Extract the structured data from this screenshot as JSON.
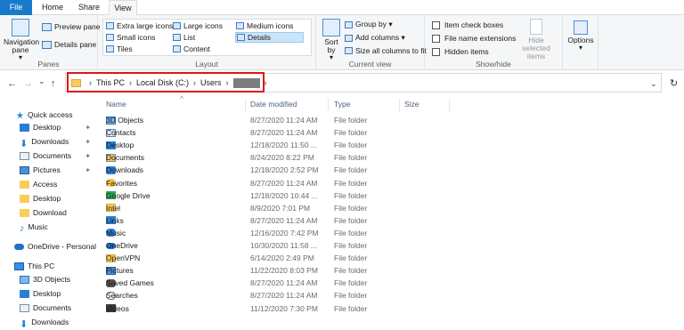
{
  "tabs": [
    "File",
    "Home",
    "Share",
    "View"
  ],
  "ribbon": {
    "panes": {
      "navigation_pane": "Navigation pane",
      "navigation_pane_arrow": "▾",
      "preview_pane": "Preview pane",
      "details_pane": "Details pane",
      "label": "Panes"
    },
    "layout": {
      "items": [
        "Extra large icons",
        "Large icons",
        "Medium icons",
        "Small icons",
        "List",
        "Details",
        "Tiles",
        "Content"
      ],
      "label": "Layout"
    },
    "current_view": {
      "sort_by": "Sort by",
      "sort_by_arrow": "▾",
      "group_by": "Group by ▾",
      "add_columns": "Add columns ▾",
      "size_all_columns": "Size all columns to fit",
      "label": "Current view"
    },
    "show_hide": {
      "item_check_boxes": "Item check boxes",
      "file_name_extensions": "File name extensions",
      "hidden_items": "Hidden items",
      "hide_selected": "Hide selected",
      "hide_selected_2": "items",
      "label": "Show/hide"
    },
    "options": {
      "label": "Options",
      "arrow": "▾"
    }
  },
  "nav": {
    "back": "←",
    "forward": "→",
    "recent": "⌄",
    "up": "↑",
    "dropdown": "⌄",
    "refresh": "↻"
  },
  "address": {
    "crumbs": [
      "This PC",
      "Local Disk (C:)",
      "Users"
    ],
    "separator": "›",
    "trailing": "›"
  },
  "navpane": {
    "pin": "✦",
    "items": [
      {
        "label": "Quick access",
        "icon": "star-icon"
      },
      {
        "label": "Desktop",
        "icon": "desktop-icon"
      },
      {
        "label": "Downloads",
        "icon": "download-icon"
      },
      {
        "label": "Documents",
        "icon": "documents-icon"
      },
      {
        "label": "Pictures",
        "icon": "pictures-icon"
      },
      {
        "label": "Access",
        "icon": "folder-icon"
      },
      {
        "label": "Desktop",
        "icon": "folder-icon"
      },
      {
        "label": "Download",
        "icon": "folder-icon"
      },
      {
        "label": "Music",
        "icon": "music-icon"
      },
      {
        "label": "OneDrive - Personal",
        "icon": "cloud-icon"
      },
      {
        "label": "This PC",
        "icon": "computer-icon"
      },
      {
        "label": "3D Objects",
        "icon": "cube-icon"
      },
      {
        "label": "Desktop",
        "icon": "desktop-icon"
      },
      {
        "label": "Documents",
        "icon": "documents-icon"
      },
      {
        "label": "Downloads",
        "icon": "download-icon"
      }
    ]
  },
  "columns": {
    "name": "Name",
    "date": "Date modified",
    "type": "Type",
    "size": "Size",
    "sort_indicator": "^"
  },
  "files": [
    {
      "name": "3D Objects",
      "date": "8/27/2020 11:24 AM",
      "type": "File folder",
      "icon": "cube-icon"
    },
    {
      "name": "Contacts",
      "date": "8/27/2020 11:24 AM",
      "type": "File folder",
      "icon": "contacts-icon"
    },
    {
      "name": "Desktop",
      "date": "12/18/2020 11:50 ...",
      "type": "File folder",
      "icon": "desktop-icon"
    },
    {
      "name": "Documents",
      "date": "8/24/2020 8:22 PM",
      "type": "File folder",
      "icon": "documents-icon"
    },
    {
      "name": "Downloads",
      "date": "12/18/2020 2:52 PM",
      "type": "File folder",
      "icon": "download-icon"
    },
    {
      "name": "Favorites",
      "date": "8/27/2020 11:24 AM",
      "type": "File folder",
      "icon": "star-icon"
    },
    {
      "name": "Google Drive",
      "date": "12/18/2020 10:44 ...",
      "type": "File folder",
      "icon": "drive-icon"
    },
    {
      "name": "Intel",
      "date": "8/9/2020 7:01 PM",
      "type": "File folder",
      "icon": "folder-icon"
    },
    {
      "name": "Links",
      "date": "8/27/2020 11:24 AM",
      "type": "File folder",
      "icon": "link-icon"
    },
    {
      "name": "Music",
      "date": "12/16/2020 7:42 PM",
      "type": "File folder",
      "icon": "music-icon"
    },
    {
      "name": "OneDrive",
      "date": "10/30/2020 11:58 ...",
      "type": "File folder",
      "icon": "cloud-icon"
    },
    {
      "name": "OpenVPN",
      "date": "6/14/2020 2:49 PM",
      "type": "File folder",
      "icon": "folder-icon"
    },
    {
      "name": "Pictures",
      "date": "11/22/2020 8:03 PM",
      "type": "File folder",
      "icon": "pictures-icon"
    },
    {
      "name": "Saved Games",
      "date": "8/27/2020 11:24 AM",
      "type": "File folder",
      "icon": "games-icon"
    },
    {
      "name": "Searches",
      "date": "8/27/2020 11:24 AM",
      "type": "File folder",
      "icon": "search-icon"
    },
    {
      "name": "Videos",
      "date": "11/12/2020 7:30 PM",
      "type": "File folder",
      "icon": "videos-icon"
    }
  ],
  "colors": {
    "accent": "#1979ca",
    "highlight": "#e2131a",
    "folder": "#f8cd5a"
  }
}
